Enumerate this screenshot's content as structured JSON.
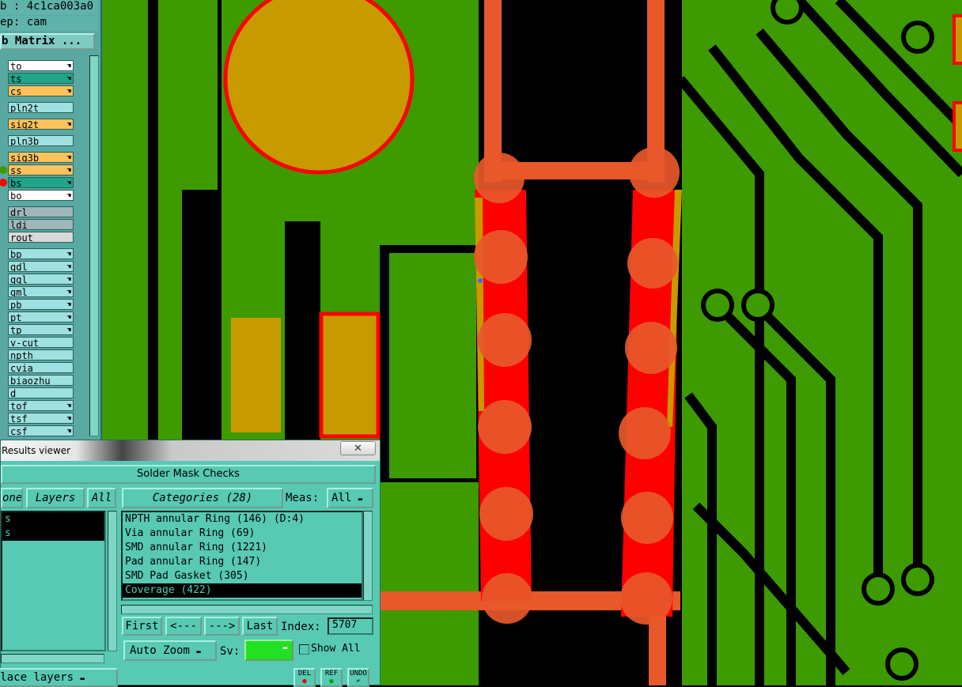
{
  "job_info": {
    "job_line": "b : 4c1ca003a0",
    "step_line": "ep: cam"
  },
  "matrix_button": "b Matrix ...",
  "layers": [
    {
      "name": "to",
      "color": "#ffffff",
      "hand": true
    },
    {
      "name": "ts",
      "color": "#1fa589",
      "hand": true
    },
    {
      "name": "cs",
      "color": "#ffc25a",
      "hand": true
    },
    {
      "name": "pln2t",
      "color": "#9fe0e0",
      "hand": false
    },
    {
      "name": "sig2t",
      "color": "#ffc25a",
      "hand": true
    },
    {
      "name": "pln3b",
      "color": "#9fe0e0",
      "hand": false
    },
    {
      "name": "sig3b",
      "color": "#ffc25a",
      "hand": true
    },
    {
      "name": "ss",
      "color": "#ffc25a",
      "hand": true
    },
    {
      "name": "bs",
      "color": "#1fa589",
      "hand": true
    },
    {
      "name": "bo",
      "color": "#ffffff",
      "hand": true
    },
    {
      "name": "drl",
      "color": "#9fb6bb",
      "hand": false
    },
    {
      "name": "ldi",
      "color": "#9fb6bb",
      "hand": false
    },
    {
      "name": "rout",
      "color": "#d9d9d9",
      "hand": false
    },
    {
      "name": "bp",
      "color": "#9fe0e0",
      "hand": true
    },
    {
      "name": "gdl",
      "color": "#9fe0e0",
      "hand": true
    },
    {
      "name": "ggl",
      "color": "#9fe0e0",
      "hand": true
    },
    {
      "name": "gml",
      "color": "#9fe0e0",
      "hand": true
    },
    {
      "name": "pb",
      "color": "#9fe0e0",
      "hand": true
    },
    {
      "name": "pt",
      "color": "#9fe0e0",
      "hand": true
    },
    {
      "name": "tp",
      "color": "#9fe0e0",
      "hand": true
    },
    {
      "name": "v-cut",
      "color": "#9fe0e0",
      "hand": false
    },
    {
      "name": "npth",
      "color": "#9fe0e0",
      "hand": false
    },
    {
      "name": "cvia",
      "color": "#9fe0e0",
      "hand": false
    },
    {
      "name": "biaozhu",
      "color": "#9fe0e0",
      "hand": false
    },
    {
      "name": "d",
      "color": "#9fe0e0",
      "hand": false
    },
    {
      "name": "tof",
      "color": "#9fe0e0",
      "hand": true
    },
    {
      "name": "tsf",
      "color": "#9fe0e0",
      "hand": true
    },
    {
      "name": "csf",
      "color": "#9fe0e0",
      "hand": true
    }
  ],
  "results_viewer": {
    "title": "Results viewer",
    "close": "✕",
    "header": "Solder Mask Checks",
    "none_btn": "one",
    "layers_btn": "Layers",
    "all_btn": "All",
    "categories_btn": "Categories (28)",
    "meas_label": "Meas:",
    "meas_value": "All",
    "left_list": [
      "s",
      "s"
    ],
    "categories": [
      "NPTH annular Ring (146)   (D:4)",
      "Via annular Ring (69)",
      "SMD annular Ring (1221)",
      "Pad annular Ring (147)",
      "SMD Pad Gasket (305)",
      "Coverage (422)"
    ],
    "selected_index": 5,
    "first_btn": "First",
    "prev_btn": "<---",
    "next_btn": "--->",
    "last_btn": "Last",
    "index_label": "Index:",
    "index_value": "5707",
    "auto_zoom": "Auto Zoom",
    "sv_label": "Sv:",
    "show_all": "Show All",
    "replace_layers": "Replace layers",
    "small_buttons": [
      "DEL",
      "REF",
      "UNDO"
    ]
  },
  "colors": {
    "board": "#3d9a00",
    "mask": "#c79a00",
    "trace": "#e8582a",
    "error": "#ff0000",
    "panel": "#58c9b3"
  }
}
